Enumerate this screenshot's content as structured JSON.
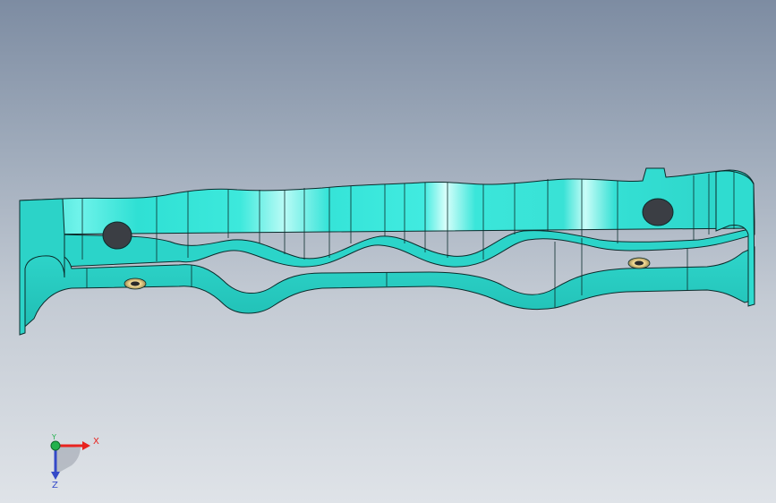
{
  "viewport": {
    "background_top": "#7d8ca2",
    "background_bottom": "#dfe3e8"
  },
  "part": {
    "face_color": "#37e6d9",
    "face_shadow": "#1fc7bd",
    "edge_color": "#0b2b2b",
    "hole_color": "#3b3e44",
    "countersink_color": "#f3e3a6"
  },
  "triad": {
    "x_label": "X",
    "y_label": "Y",
    "z_label": "Z",
    "x_color": "#e8231f",
    "y_color": "#22b14c",
    "z_color": "#3449c8"
  }
}
